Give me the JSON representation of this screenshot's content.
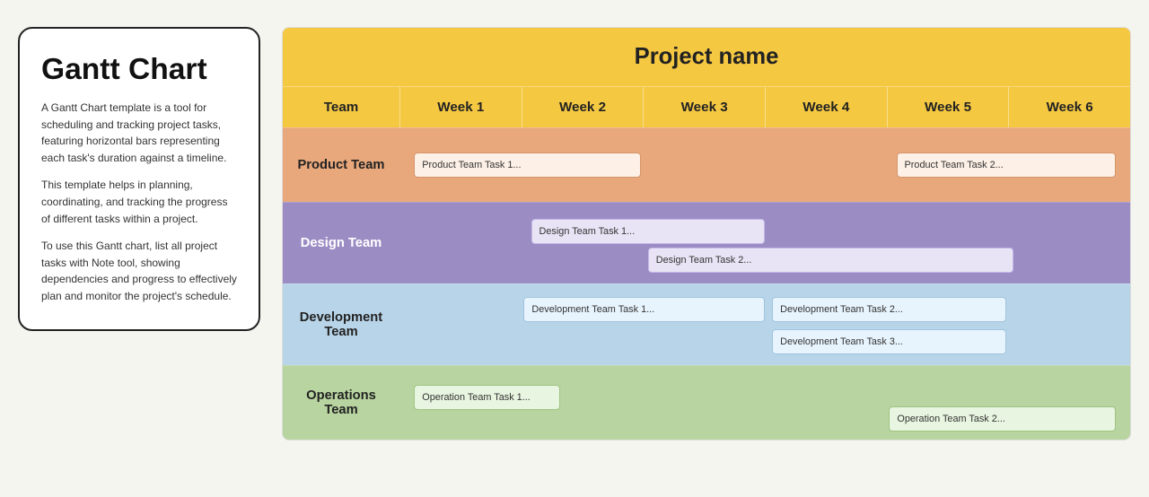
{
  "infoCard": {
    "title": "Gantt Chart",
    "paragraphs": [
      "A Gantt Chart template is a tool for scheduling and tracking project tasks, featuring horizontal bars representing each task's duration against a timeline.",
      "This template helps in planning, coordinating, and tracking the progress of different tasks within a project.",
      "To use this Gantt chart, list all project tasks with Note tool, showing dependencies and progress to effectively plan and monitor the project's schedule."
    ]
  },
  "gantt": {
    "projectName": "Project name",
    "teamHeader": "Team",
    "weeks": [
      "Week 1",
      "Week 2",
      "Week 3",
      "Week 4",
      "Week 5",
      "Week 6"
    ],
    "teams": [
      {
        "id": "product",
        "label": "Product Team",
        "tasks": [
          {
            "label": "Product Team Task 1...",
            "startCol": 0,
            "spanCols": 2,
            "row": 0
          },
          {
            "label": "Product Team Task 2...",
            "startCol": 4,
            "spanCols": 2,
            "row": 0
          }
        ]
      },
      {
        "id": "design",
        "label": "Design Team",
        "tasks": [
          {
            "label": "Design Team Task 1...",
            "startCol": 1,
            "spanCols": 2,
            "row": 0
          },
          {
            "label": "Design Team Task 2...",
            "startCol": 2,
            "spanCols": 3,
            "row": 1
          }
        ]
      },
      {
        "id": "development",
        "label": "Development Team",
        "tasks": [
          {
            "label": "Development Team Task 1...",
            "startCol": 1,
            "spanCols": 2,
            "row": 0
          },
          {
            "label": "Development Team Task 2...",
            "startCol": 3,
            "spanCols": 2,
            "row": 0
          },
          {
            "label": "Development Team Task 3...",
            "startCol": 3,
            "spanCols": 2,
            "row": 1
          }
        ]
      },
      {
        "id": "operations",
        "label": "Operations Team",
        "tasks": [
          {
            "label": "Operation Team Task 1...",
            "startCol": 0,
            "spanCols": 1.5,
            "row": 0
          },
          {
            "label": "Operation Team Task 2...",
            "startCol": 4,
            "spanCols": 2,
            "row": 1
          }
        ]
      }
    ]
  }
}
